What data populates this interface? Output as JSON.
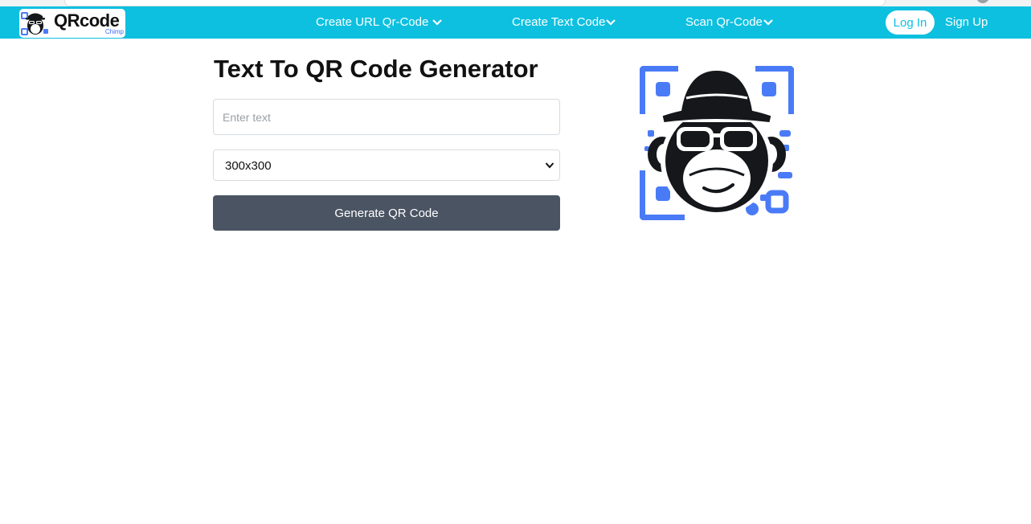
{
  "brand": {
    "name": "QRcode",
    "sub": "Chimp",
    "accent": "#0dc0e0",
    "qr_blue": "#4a7bf7",
    "logo_icon": "monkey-qr-logo-icon"
  },
  "nav": {
    "items": [
      {
        "label": "Create URL Qr-Code",
        "icon": "chevron-down-icon"
      },
      {
        "label": "Create Text Code",
        "icon": "chevron-down-icon"
      },
      {
        "label": "Scan Qr-Code",
        "icon": "chevron-down-icon"
      }
    ],
    "login_label": "Log In",
    "signup_label": "Sign Up"
  },
  "main": {
    "title": "Text To QR Code Generator",
    "text_input": {
      "placeholder": "Enter text",
      "value": ""
    },
    "size_select": {
      "value": "300x300"
    },
    "generate_label": "Generate QR Code",
    "hero_icon": "monkey-qr-illustration"
  },
  "colors": {
    "button_bg": "#4a5463",
    "title": "#111111"
  }
}
